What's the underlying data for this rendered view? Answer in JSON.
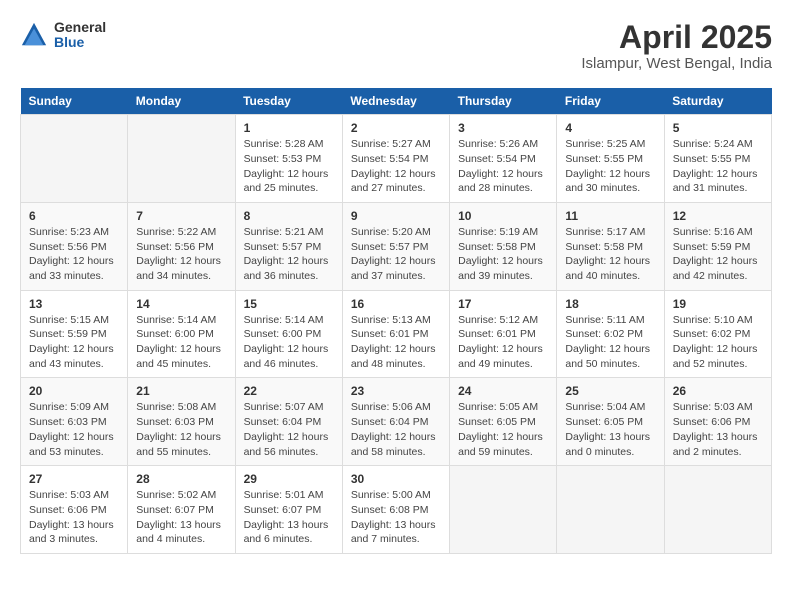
{
  "logo": {
    "general": "General",
    "blue": "Blue"
  },
  "header": {
    "title": "April 2025",
    "subtitle": "Islampur, West Bengal, India"
  },
  "weekdays": [
    "Sunday",
    "Monday",
    "Tuesday",
    "Wednesday",
    "Thursday",
    "Friday",
    "Saturday"
  ],
  "weeks": [
    [
      {
        "day": "",
        "info": ""
      },
      {
        "day": "",
        "info": ""
      },
      {
        "day": "1",
        "info": "Sunrise: 5:28 AM\nSunset: 5:53 PM\nDaylight: 12 hours and 25 minutes."
      },
      {
        "day": "2",
        "info": "Sunrise: 5:27 AM\nSunset: 5:54 PM\nDaylight: 12 hours and 27 minutes."
      },
      {
        "day": "3",
        "info": "Sunrise: 5:26 AM\nSunset: 5:54 PM\nDaylight: 12 hours and 28 minutes."
      },
      {
        "day": "4",
        "info": "Sunrise: 5:25 AM\nSunset: 5:55 PM\nDaylight: 12 hours and 30 minutes."
      },
      {
        "day": "5",
        "info": "Sunrise: 5:24 AM\nSunset: 5:55 PM\nDaylight: 12 hours and 31 minutes."
      }
    ],
    [
      {
        "day": "6",
        "info": "Sunrise: 5:23 AM\nSunset: 5:56 PM\nDaylight: 12 hours and 33 minutes."
      },
      {
        "day": "7",
        "info": "Sunrise: 5:22 AM\nSunset: 5:56 PM\nDaylight: 12 hours and 34 minutes."
      },
      {
        "day": "8",
        "info": "Sunrise: 5:21 AM\nSunset: 5:57 PM\nDaylight: 12 hours and 36 minutes."
      },
      {
        "day": "9",
        "info": "Sunrise: 5:20 AM\nSunset: 5:57 PM\nDaylight: 12 hours and 37 minutes."
      },
      {
        "day": "10",
        "info": "Sunrise: 5:19 AM\nSunset: 5:58 PM\nDaylight: 12 hours and 39 minutes."
      },
      {
        "day": "11",
        "info": "Sunrise: 5:17 AM\nSunset: 5:58 PM\nDaylight: 12 hours and 40 minutes."
      },
      {
        "day": "12",
        "info": "Sunrise: 5:16 AM\nSunset: 5:59 PM\nDaylight: 12 hours and 42 minutes."
      }
    ],
    [
      {
        "day": "13",
        "info": "Sunrise: 5:15 AM\nSunset: 5:59 PM\nDaylight: 12 hours and 43 minutes."
      },
      {
        "day": "14",
        "info": "Sunrise: 5:14 AM\nSunset: 6:00 PM\nDaylight: 12 hours and 45 minutes."
      },
      {
        "day": "15",
        "info": "Sunrise: 5:14 AM\nSunset: 6:00 PM\nDaylight: 12 hours and 46 minutes."
      },
      {
        "day": "16",
        "info": "Sunrise: 5:13 AM\nSunset: 6:01 PM\nDaylight: 12 hours and 48 minutes."
      },
      {
        "day": "17",
        "info": "Sunrise: 5:12 AM\nSunset: 6:01 PM\nDaylight: 12 hours and 49 minutes."
      },
      {
        "day": "18",
        "info": "Sunrise: 5:11 AM\nSunset: 6:02 PM\nDaylight: 12 hours and 50 minutes."
      },
      {
        "day": "19",
        "info": "Sunrise: 5:10 AM\nSunset: 6:02 PM\nDaylight: 12 hours and 52 minutes."
      }
    ],
    [
      {
        "day": "20",
        "info": "Sunrise: 5:09 AM\nSunset: 6:03 PM\nDaylight: 12 hours and 53 minutes."
      },
      {
        "day": "21",
        "info": "Sunrise: 5:08 AM\nSunset: 6:03 PM\nDaylight: 12 hours and 55 minutes."
      },
      {
        "day": "22",
        "info": "Sunrise: 5:07 AM\nSunset: 6:04 PM\nDaylight: 12 hours and 56 minutes."
      },
      {
        "day": "23",
        "info": "Sunrise: 5:06 AM\nSunset: 6:04 PM\nDaylight: 12 hours and 58 minutes."
      },
      {
        "day": "24",
        "info": "Sunrise: 5:05 AM\nSunset: 6:05 PM\nDaylight: 12 hours and 59 minutes."
      },
      {
        "day": "25",
        "info": "Sunrise: 5:04 AM\nSunset: 6:05 PM\nDaylight: 13 hours and 0 minutes."
      },
      {
        "day": "26",
        "info": "Sunrise: 5:03 AM\nSunset: 6:06 PM\nDaylight: 13 hours and 2 minutes."
      }
    ],
    [
      {
        "day": "27",
        "info": "Sunrise: 5:03 AM\nSunset: 6:06 PM\nDaylight: 13 hours and 3 minutes."
      },
      {
        "day": "28",
        "info": "Sunrise: 5:02 AM\nSunset: 6:07 PM\nDaylight: 13 hours and 4 minutes."
      },
      {
        "day": "29",
        "info": "Sunrise: 5:01 AM\nSunset: 6:07 PM\nDaylight: 13 hours and 6 minutes."
      },
      {
        "day": "30",
        "info": "Sunrise: 5:00 AM\nSunset: 6:08 PM\nDaylight: 13 hours and 7 minutes."
      },
      {
        "day": "",
        "info": ""
      },
      {
        "day": "",
        "info": ""
      },
      {
        "day": "",
        "info": ""
      }
    ]
  ]
}
